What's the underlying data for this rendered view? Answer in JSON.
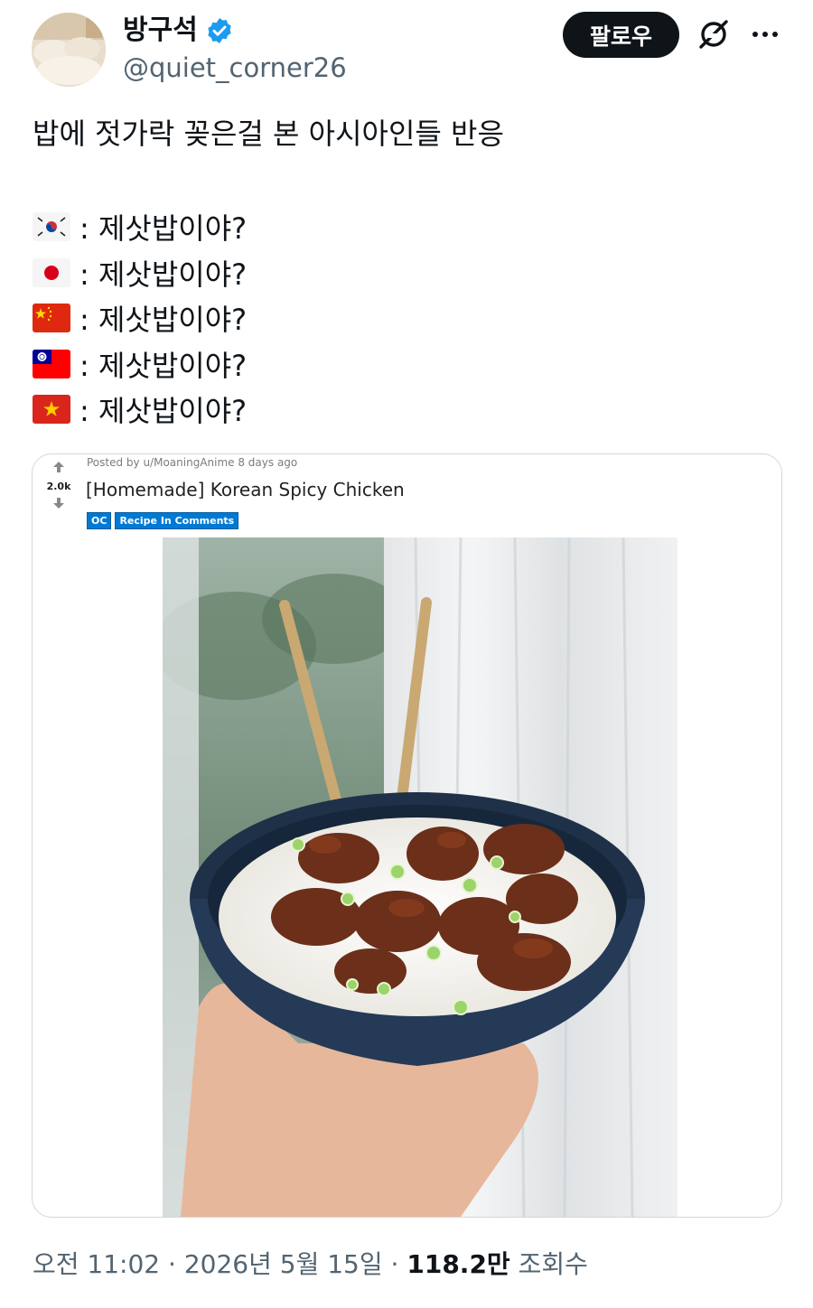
{
  "header": {
    "display_name": "방구석",
    "handle": "@quiet_corner26",
    "follow_label": "팔로우",
    "avatar_icon": "avatar-bedroom-photo",
    "verified_icon": "verified-badge-icon",
    "grok_icon": "grok-icon",
    "more_icon": "more-horizontal-icon"
  },
  "tweet": {
    "text": "밥에 젓가락 꽂은걸 본 아시아인들 반응",
    "reactions": [
      {
        "flag": "south-korea-flag",
        "text": ": 제삿밥이야?"
      },
      {
        "flag": "japan-flag",
        "text": ": 제삿밥이야?"
      },
      {
        "flag": "china-flag",
        "text": ": 제삿밥이야?"
      },
      {
        "flag": "taiwan-flag",
        "text": ": 제삿밥이야?"
      },
      {
        "flag": "vietnam-flag",
        "text": ": 제삿밥이야?"
      }
    ]
  },
  "media": {
    "posted_by": "Posted by u/MoaningAnime 8 days ago",
    "vote_count": "2.0k",
    "title": "[Homemade] Korean Spicy Chicken",
    "flairs": [
      "OC",
      "Recipe In Comments"
    ]
  },
  "meta": {
    "time": "오전 11:02",
    "separator": "·",
    "date": "2026년 5월 15일",
    "views_count": "118.2만",
    "views_label": "조회수"
  },
  "colors": {
    "text": "#0f1419",
    "secondary": "#536471",
    "verified": "#1d9bf0",
    "border": "#cfd9de",
    "flair": "#0079d3"
  }
}
